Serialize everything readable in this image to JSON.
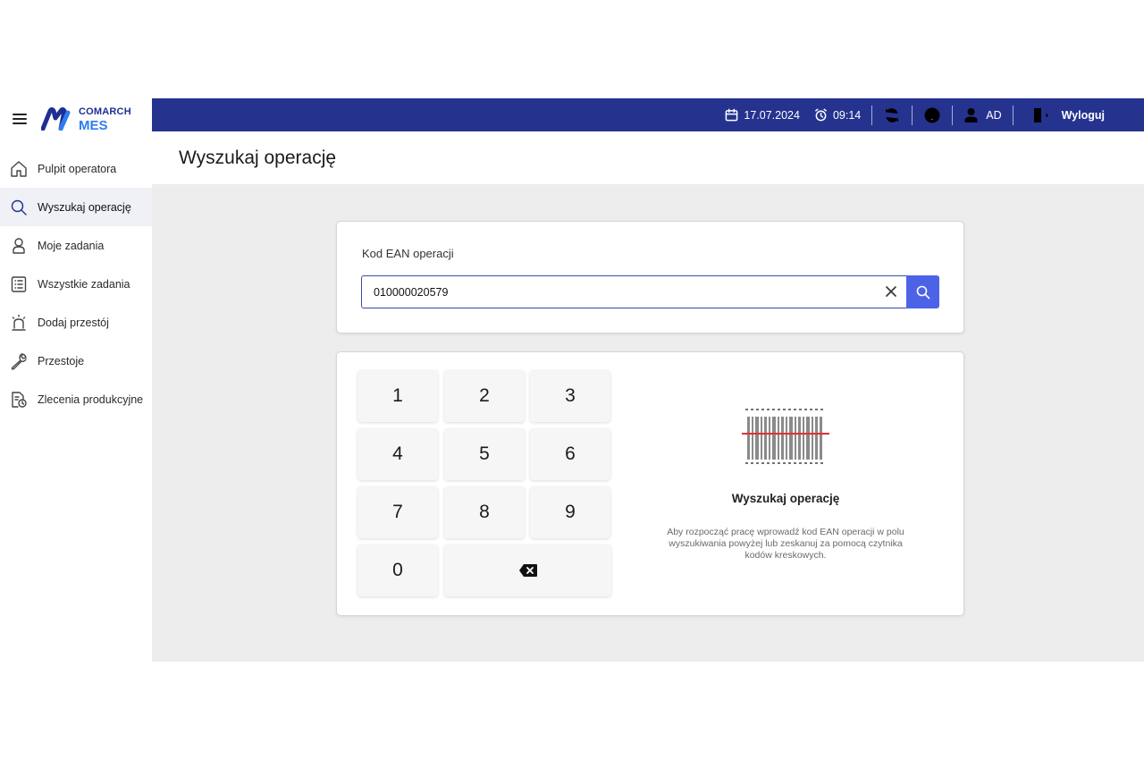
{
  "brand": {
    "line1": "COMARCH",
    "line2": "MES"
  },
  "sidebar": {
    "items": [
      {
        "label": "Pulpit operatora",
        "icon": "home-icon"
      },
      {
        "label": "Wyszukaj operację",
        "icon": "search-icon",
        "active": true
      },
      {
        "label": "Moje zadania",
        "icon": "person-icon"
      },
      {
        "label": "Wszystkie zadania",
        "icon": "list-icon"
      },
      {
        "label": "Dodaj przestój",
        "icon": "alarm-light-icon"
      },
      {
        "label": "Przestoje",
        "icon": "wrench-icon"
      },
      {
        "label": "Zlecenia produkcyjne",
        "icon": "document-clock-icon"
      }
    ]
  },
  "topbar": {
    "date": "17.07.2024",
    "time": "09:14",
    "user": "AD",
    "logout": "Wyloguj",
    "color": "#25338f"
  },
  "page": {
    "title": "Wyszukaj operację"
  },
  "search": {
    "label": "Kod EAN operacji",
    "value": "010000020579",
    "button_color": "#4c63e8"
  },
  "keypad": {
    "keys": [
      "1",
      "2",
      "3",
      "4",
      "5",
      "6",
      "7",
      "8",
      "9",
      "0"
    ]
  },
  "info": {
    "title": "Wyszukaj operację",
    "description": "Aby rozpocząć pracę wprowadź kod EAN operacji w polu wyszukiwania powyżej lub zeskanuj za pomocą czytnika kodów kreskowych."
  }
}
